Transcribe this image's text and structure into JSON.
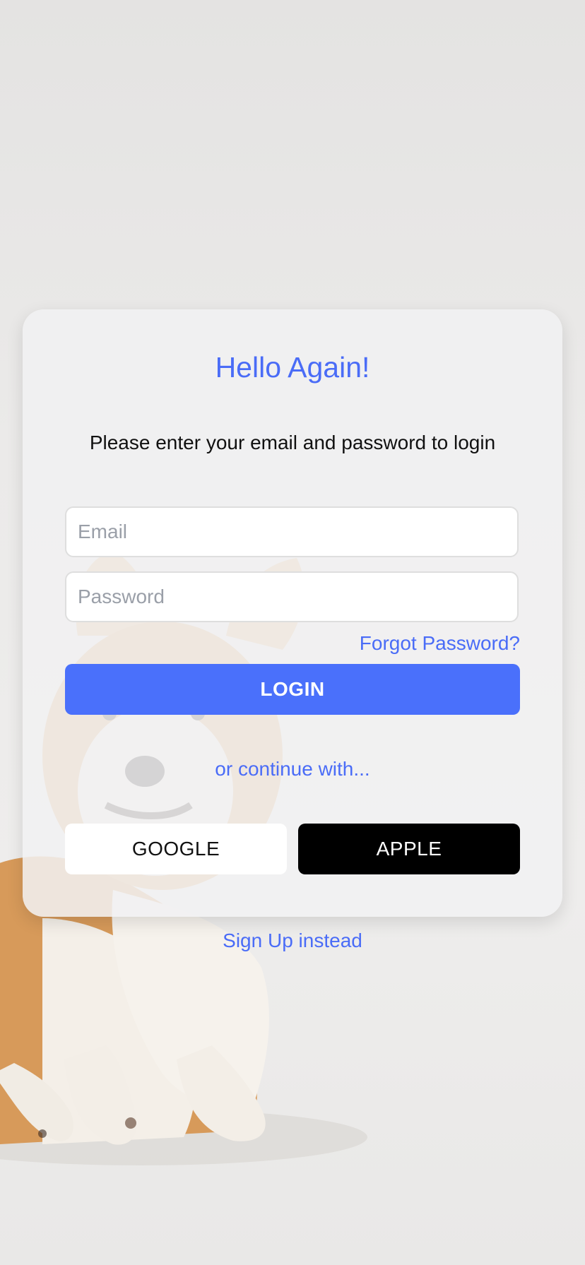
{
  "login_card": {
    "title": "Hello Again!",
    "subtitle": "Please enter your email and password to login",
    "email_placeholder": "Email",
    "password_placeholder": "Password",
    "forgot_password_label": "Forgot Password?",
    "login_button_label": "LOGIN",
    "continue_with_label": "or continue with...",
    "google_button_label": "GOOGLE",
    "apple_button_label": "APPLE"
  },
  "signup_link_label": "Sign Up instead",
  "colors": {
    "accent": "#4a6cf7",
    "login_button": "#4a70fb",
    "apple_button": "#000000",
    "google_button": "#ffffff"
  }
}
